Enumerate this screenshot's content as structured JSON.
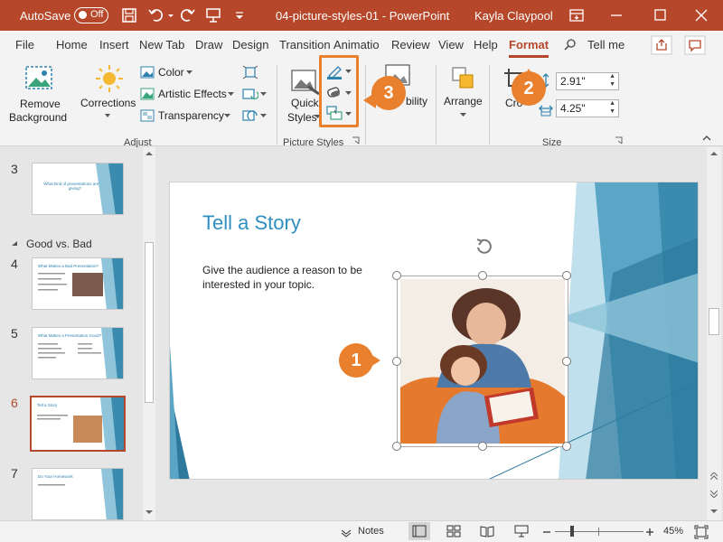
{
  "titlebar": {
    "autosave_label": "AutoSave",
    "toggle_label": "Off",
    "doc_title": "04-picture-styles-01 - PowerPoint",
    "user_name": "Kayla Claypool"
  },
  "tabs": [
    {
      "label": "File"
    },
    {
      "label": "Home"
    },
    {
      "label": "Insert"
    },
    {
      "label": "New Tab"
    },
    {
      "label": "Draw"
    },
    {
      "label": "Design"
    },
    {
      "label": "Transition"
    },
    {
      "label": "Animatio"
    },
    {
      "label": "Review"
    },
    {
      "label": "View"
    },
    {
      "label": "Help"
    },
    {
      "label": "Format"
    },
    {
      "label": "Tell me"
    }
  ],
  "ribbon": {
    "remove_bg_line1": "Remove",
    "remove_bg_line2": "Background",
    "corrections": "Corrections",
    "color": "Color",
    "artistic_effects": "Artistic Effects",
    "transparency": "Transparency",
    "adjust_group": "Adjust",
    "quick_styles_line1": "Quick",
    "quick_styles_line2": "Styles",
    "picture_styles_group": "Picture Styles",
    "accessibility_partial": "bility",
    "arrange": "Arrange",
    "crop_partial": "Cro",
    "height_value": "2.91\"",
    "width_value": "4.25\"",
    "size_group": "Size"
  },
  "slides_panel": {
    "section_label": "Good vs. Bad",
    "slides": [
      {
        "number": "3",
        "thumb_title": "What kind of presentations are you giving?"
      },
      {
        "number": "4",
        "thumb_title": "What Makes a Bad Presentation?"
      },
      {
        "number": "5",
        "thumb_title": "What Makes a Presentation Good?"
      },
      {
        "number": "6",
        "thumb_title": "Tell a Story"
      },
      {
        "number": "7",
        "thumb_title": "Do Your Homework"
      }
    ]
  },
  "slide": {
    "title": "Tell a Story",
    "body": "Give the audience a reason to be interested in your topic."
  },
  "status": {
    "notes": "Notes",
    "zoom": "45%",
    "zoom_level": 0.45
  },
  "callouts": [
    "1",
    "2",
    "3"
  ],
  "colors": {
    "accent": "#b7472a",
    "callout": "#e8802e",
    "slide_title": "#2e8fc0",
    "slide_teal": "#3a8bad"
  }
}
